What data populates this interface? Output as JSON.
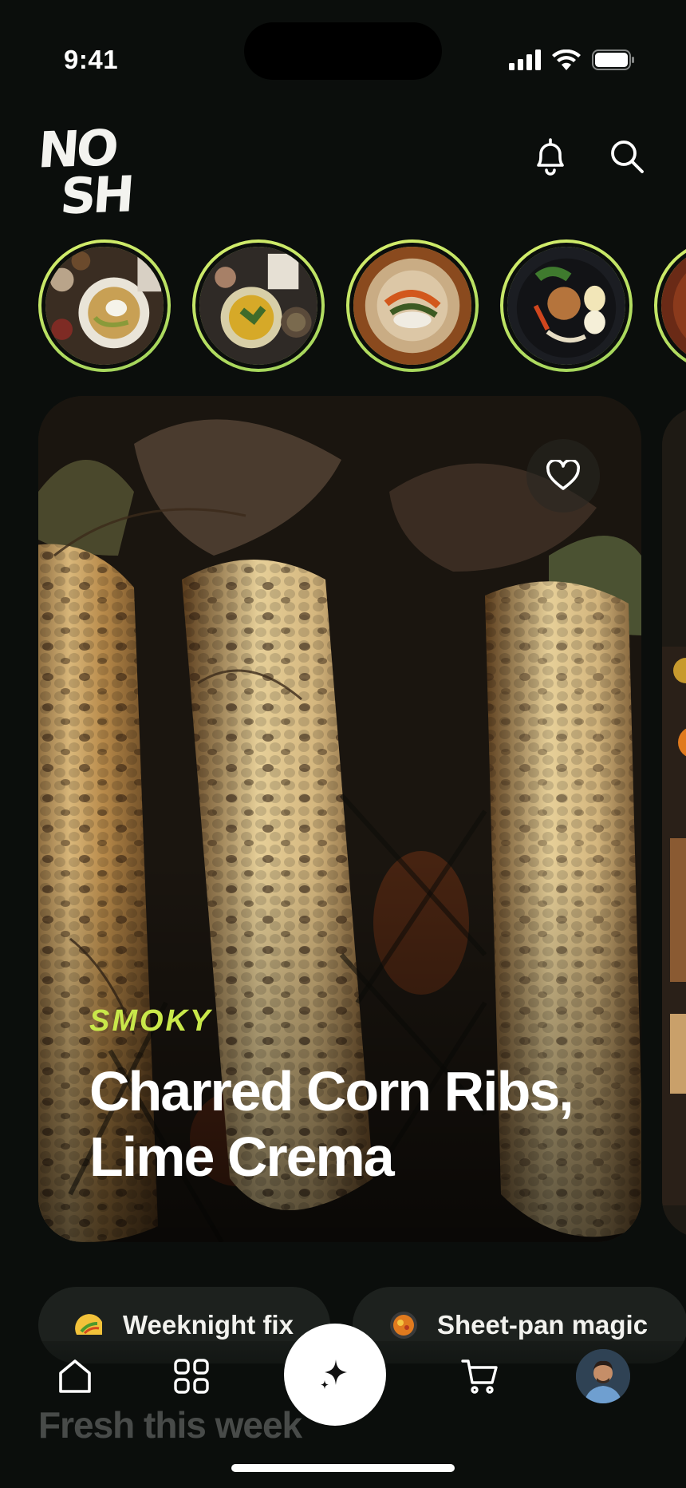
{
  "status_bar": {
    "time": "9:41",
    "icons": [
      "signal-icon",
      "wifi-icon",
      "battery-icon"
    ]
  },
  "header": {
    "logo_line1": "NO",
    "logo_line2": "SH",
    "icons": [
      "bell-icon",
      "search-icon"
    ]
  },
  "stories": [
    {
      "name": "story-1"
    },
    {
      "name": "story-2"
    },
    {
      "name": "story-3"
    },
    {
      "name": "story-4"
    },
    {
      "name": "story-5"
    }
  ],
  "hero": {
    "tag": "SMOKY",
    "title": "Charred Corn Ribs, Lime Crema",
    "favorite_icon": "heart-icon"
  },
  "chips": [
    {
      "emoji": "taco",
      "label": "Weeknight fix"
    },
    {
      "emoji": "sheet-pan",
      "label": "Sheet-pan magic"
    }
  ],
  "section": {
    "title": "Fresh this week"
  },
  "bottom_nav": {
    "items": [
      "home-icon",
      "grid-icon",
      "sparkle-icon",
      "cart-icon",
      "avatar"
    ],
    "active": "home-icon"
  },
  "colors": {
    "background": "#0b0e0c",
    "accent": "#c9e84a",
    "ring_gradient": [
      "#d7ef6c",
      "#9fd35a"
    ],
    "chip_bg": "#1d211e"
  }
}
